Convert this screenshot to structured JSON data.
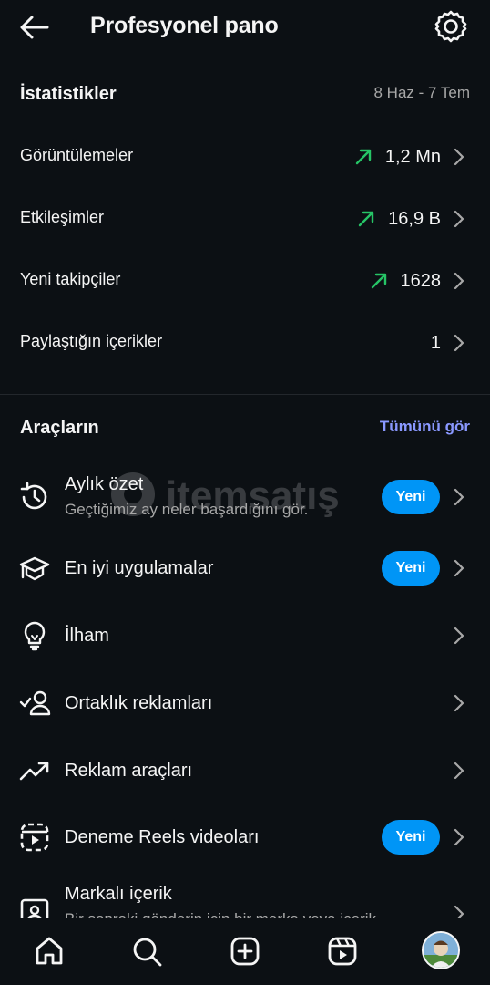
{
  "header": {
    "title": "Profesyonel pano",
    "back_icon": "arrow-left-icon",
    "settings_icon": "gear-icon"
  },
  "statistics": {
    "title": "İstatistikler",
    "date_range": "8 Haz - 7 Tem",
    "rows": [
      {
        "label": "Görüntülemeler",
        "value": "1,2 Mn",
        "trend": "up"
      },
      {
        "label": "Etkileşimler",
        "value": "16,9 B",
        "trend": "up"
      },
      {
        "label": "Yeni takipçiler",
        "value": "1628",
        "trend": "up"
      },
      {
        "label": "Paylaştığın içerikler",
        "value": "1",
        "trend": "none"
      }
    ]
  },
  "tools": {
    "title": "Araçların",
    "see_all": "Tümünü gör",
    "items": [
      {
        "label": "Aylık özet",
        "sub": "Geçtiğimiz ay neler başardığını gör.",
        "badge": "Yeni",
        "icon": "history-clock-icon"
      },
      {
        "label": "En iyi uygulamalar",
        "badge": "Yeni",
        "icon": "graduation-cap-icon"
      },
      {
        "label": "İlham",
        "icon": "lightbulb-icon"
      },
      {
        "label": "Ortaklık reklamları",
        "icon": "user-check-icon"
      },
      {
        "label": "Reklam araçları",
        "icon": "trending-up-icon"
      },
      {
        "label": "Deneme Reels videoları",
        "badge": "Yeni",
        "icon": "reels-dashed-icon"
      },
      {
        "label": "Markalı içerik",
        "sub": "Bir sonraki gönderin için bir marka veya içerik",
        "icon": "id-card-icon"
      }
    ]
  },
  "watermark": {
    "text": "itemsatış"
  },
  "tab_bar": {
    "items": [
      {
        "name": "home-icon"
      },
      {
        "name": "search-icon"
      },
      {
        "name": "create-plus-icon"
      },
      {
        "name": "reels-icon"
      },
      {
        "name": "profile-avatar"
      }
    ]
  },
  "colors": {
    "background": "#0c1014",
    "accent_blue": "#0095f6",
    "link_blue": "#8a98ff",
    "trend_green": "#26c466",
    "muted_text": "#a8a8a8"
  }
}
